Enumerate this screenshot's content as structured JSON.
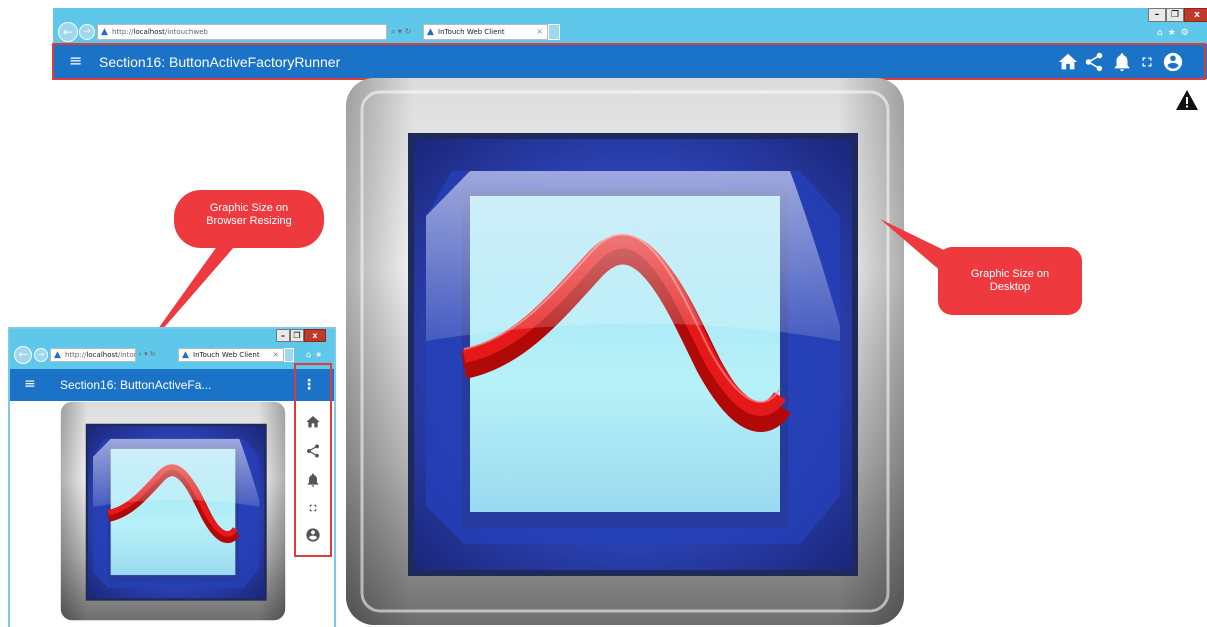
{
  "browser": {
    "url_prefix": "http://",
    "url_host": "localhost",
    "url_path": "/intouchweb",
    "address_tools": "⌕ ▾ ↻",
    "tab_title": "InTouch Web Client",
    "tab_close": "×",
    "window_buttons": {
      "minimize": "–",
      "maximize": "❐",
      "close": "x"
    },
    "toolbar_icons": [
      "home-icon",
      "star-icon",
      "gear-icon"
    ],
    "back_glyph": "←",
    "forward_glyph": "→"
  },
  "app": {
    "menu_glyph": "≡",
    "title": "Section16: ButtonActiveFactoryRunner",
    "title_truncated": "Section16: ButtonActiveFa...",
    "overflow_glyph": "⋮",
    "actions": [
      "home-icon",
      "share-icon",
      "bell-icon",
      "fullscreen-icon",
      "account-icon"
    ]
  },
  "callouts": {
    "resizing": "Graphic Size on\nBrowser Resizing",
    "desktop": "Graphic Size on\nDesktop"
  },
  "colors": {
    "chrome": "#5ec7ea",
    "app_bar": "#1a73c6",
    "highlight": "#e03b3b",
    "callout": "#ee3a3f",
    "curve": "#d40d0d",
    "screen": "#9fe3f2"
  }
}
